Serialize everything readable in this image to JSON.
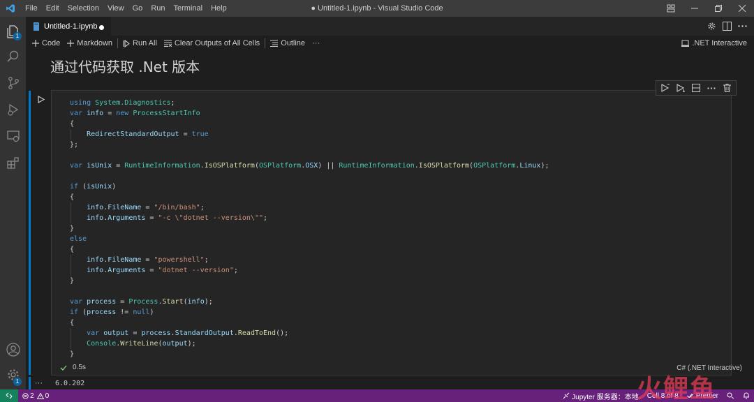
{
  "window": {
    "title": "● Untitled-1.ipynb - Visual Studio Code",
    "menu": [
      "File",
      "Edit",
      "Selection",
      "View",
      "Go",
      "Run",
      "Terminal",
      "Help"
    ]
  },
  "activity_bar": {
    "explorer_badge": "1",
    "settings_badge": "1"
  },
  "tab": {
    "label": "Untitled-1.ipynb"
  },
  "notebook_toolbar": {
    "code": "Code",
    "markdown": "Markdown",
    "run_all": "Run All",
    "clear_outputs": "Clear Outputs of All Cells",
    "outline": "Outline",
    "more": "···",
    "kernel": ".NET Interactive"
  },
  "markdown_cell": {
    "heading": "通过代码获取 .Net 版本"
  },
  "code_cell": {
    "lines": [
      [
        {
          "t": "kw",
          "v": "using"
        },
        {
          "t": "pl",
          "v": " "
        },
        {
          "t": "ty",
          "v": "System.Diagnostics"
        },
        {
          "t": "pl",
          "v": ";"
        }
      ],
      [
        {
          "t": "kw",
          "v": "var"
        },
        {
          "t": "pl",
          "v": " "
        },
        {
          "t": "va",
          "v": "info"
        },
        {
          "t": "pl",
          "v": " = "
        },
        {
          "t": "kw",
          "v": "new"
        },
        {
          "t": "pl",
          "v": " "
        },
        {
          "t": "ty",
          "v": "ProcessStartInfo"
        }
      ],
      [
        {
          "t": "pl",
          "v": "{"
        }
      ],
      [
        {
          "t": "pl",
          "v": "    "
        },
        {
          "t": "va",
          "v": "RedirectStandardOutput"
        },
        {
          "t": "pl",
          "v": " = "
        },
        {
          "t": "kw",
          "v": "true"
        }
      ],
      [
        {
          "t": "pl",
          "v": "};"
        }
      ],
      [],
      [
        {
          "t": "kw",
          "v": "var"
        },
        {
          "t": "pl",
          "v": " "
        },
        {
          "t": "va",
          "v": "isUnix"
        },
        {
          "t": "pl",
          "v": " = "
        },
        {
          "t": "ty",
          "v": "RuntimeInformation"
        },
        {
          "t": "pl",
          "v": "."
        },
        {
          "t": "fn",
          "v": "IsOSPlatform"
        },
        {
          "t": "pl",
          "v": "("
        },
        {
          "t": "ty",
          "v": "OSPlatform"
        },
        {
          "t": "pl",
          "v": "."
        },
        {
          "t": "va",
          "v": "OSX"
        },
        {
          "t": "pl",
          "v": ") || "
        },
        {
          "t": "ty",
          "v": "RuntimeInformation"
        },
        {
          "t": "pl",
          "v": "."
        },
        {
          "t": "fn",
          "v": "IsOSPlatform"
        },
        {
          "t": "pl",
          "v": "("
        },
        {
          "t": "ty",
          "v": "OSPlatform"
        },
        {
          "t": "pl",
          "v": "."
        },
        {
          "t": "va",
          "v": "Linux"
        },
        {
          "t": "pl",
          "v": ");"
        }
      ],
      [],
      [
        {
          "t": "kw",
          "v": "if"
        },
        {
          "t": "pl",
          "v": " ("
        },
        {
          "t": "va",
          "v": "isUnix"
        },
        {
          "t": "pl",
          "v": ")"
        }
      ],
      [
        {
          "t": "pl",
          "v": "{"
        }
      ],
      [
        {
          "t": "pl",
          "v": "    "
        },
        {
          "t": "va",
          "v": "info"
        },
        {
          "t": "pl",
          "v": "."
        },
        {
          "t": "va",
          "v": "FileName"
        },
        {
          "t": "pl",
          "v": " = "
        },
        {
          "t": "st",
          "v": "\"/bin/bash\""
        },
        {
          "t": "pl",
          "v": ";"
        }
      ],
      [
        {
          "t": "pl",
          "v": "    "
        },
        {
          "t": "va",
          "v": "info"
        },
        {
          "t": "pl",
          "v": "."
        },
        {
          "t": "va",
          "v": "Arguments"
        },
        {
          "t": "pl",
          "v": " = "
        },
        {
          "t": "st",
          "v": "\"-c \\\"dotnet --version\\\"\""
        },
        {
          "t": "pl",
          "v": ";"
        }
      ],
      [
        {
          "t": "pl",
          "v": "}"
        }
      ],
      [
        {
          "t": "kw",
          "v": "else"
        }
      ],
      [
        {
          "t": "pl",
          "v": "{"
        }
      ],
      [
        {
          "t": "pl",
          "v": "    "
        },
        {
          "t": "va",
          "v": "info"
        },
        {
          "t": "pl",
          "v": "."
        },
        {
          "t": "va",
          "v": "FileName"
        },
        {
          "t": "pl",
          "v": " = "
        },
        {
          "t": "st",
          "v": "\"powershell\""
        },
        {
          "t": "pl",
          "v": ";"
        }
      ],
      [
        {
          "t": "pl",
          "v": "    "
        },
        {
          "t": "va",
          "v": "info"
        },
        {
          "t": "pl",
          "v": "."
        },
        {
          "t": "va",
          "v": "Arguments"
        },
        {
          "t": "pl",
          "v": " = "
        },
        {
          "t": "st",
          "v": "\"dotnet --version\""
        },
        {
          "t": "pl",
          "v": ";"
        }
      ],
      [
        {
          "t": "pl",
          "v": "}"
        }
      ],
      [],
      [
        {
          "t": "kw",
          "v": "var"
        },
        {
          "t": "pl",
          "v": " "
        },
        {
          "t": "va",
          "v": "process"
        },
        {
          "t": "pl",
          "v": " = "
        },
        {
          "t": "ty",
          "v": "Process"
        },
        {
          "t": "pl",
          "v": "."
        },
        {
          "t": "fn",
          "v": "Start"
        },
        {
          "t": "pl",
          "v": "("
        },
        {
          "t": "va",
          "v": "info"
        },
        {
          "t": "pl",
          "v": ");"
        }
      ],
      [
        {
          "t": "kw",
          "v": "if"
        },
        {
          "t": "pl",
          "v": " ("
        },
        {
          "t": "va",
          "v": "process"
        },
        {
          "t": "pl",
          "v": " != "
        },
        {
          "t": "kw",
          "v": "null"
        },
        {
          "t": "pl",
          "v": ")"
        }
      ],
      [
        {
          "t": "pl",
          "v": "{"
        }
      ],
      [
        {
          "t": "pl",
          "v": "    "
        },
        {
          "t": "kw",
          "v": "var"
        },
        {
          "t": "pl",
          "v": " "
        },
        {
          "t": "va",
          "v": "output"
        },
        {
          "t": "pl",
          "v": " = "
        },
        {
          "t": "va",
          "v": "process"
        },
        {
          "t": "pl",
          "v": "."
        },
        {
          "t": "va",
          "v": "StandardOutput"
        },
        {
          "t": "pl",
          "v": "."
        },
        {
          "t": "fn",
          "v": "ReadToEnd"
        },
        {
          "t": "pl",
          "v": "();"
        }
      ],
      [
        {
          "t": "pl",
          "v": "    "
        },
        {
          "t": "ty",
          "v": "Console"
        },
        {
          "t": "pl",
          "v": "."
        },
        {
          "t": "fn",
          "v": "WriteLine"
        },
        {
          "t": "pl",
          "v": "("
        },
        {
          "t": "va",
          "v": "output"
        },
        {
          "t": "pl",
          "v": ");"
        }
      ],
      [
        {
          "t": "pl",
          "v": "}"
        }
      ]
    ],
    "exec_time": "0.5s",
    "language": "C# (.NET Interactive)"
  },
  "output": {
    "dots": "···",
    "text": "6.0.202"
  },
  "status_bar": {
    "errors": "2",
    "warnings": "0",
    "jupyter": "Jupyter 服务器：本地",
    "cell": "Cell 8 of 8",
    "prettier": "Prettier"
  },
  "watermark": "火鲤鱼",
  "colors": {
    "accent": "#007acc",
    "status_bar": "#68217a",
    "remote": "#16825d"
  }
}
